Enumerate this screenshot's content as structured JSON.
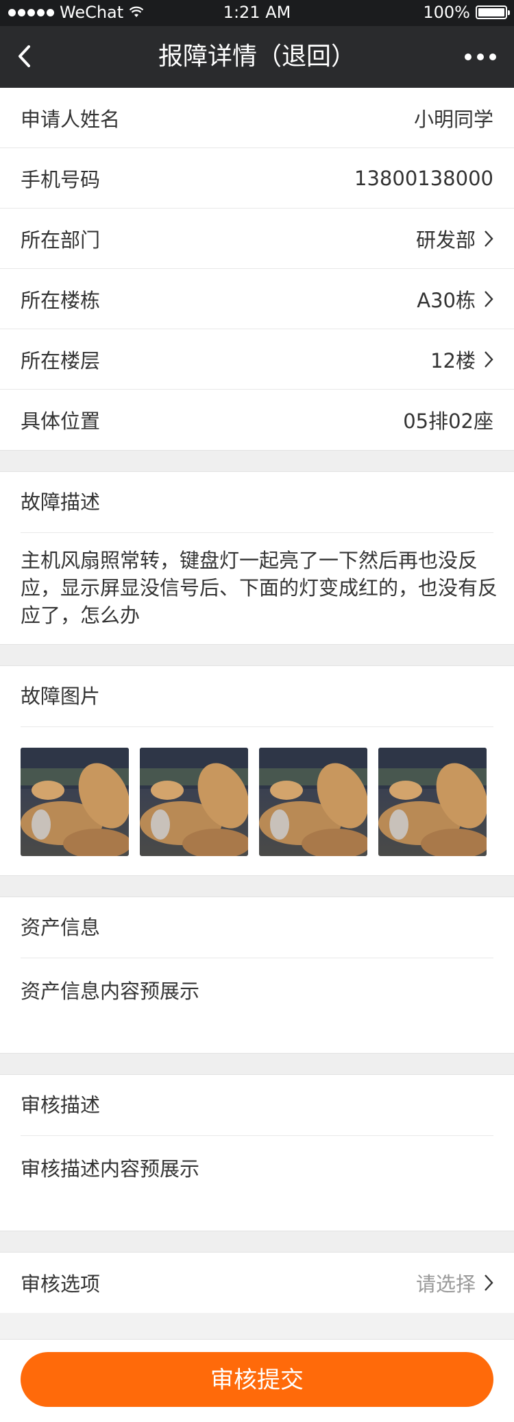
{
  "statusbar": {
    "carrier": "WeChat",
    "time": "1:21 AM",
    "battery": "100%"
  },
  "navbar": {
    "title": "报障详情（退回）"
  },
  "info_rows": [
    {
      "label": "申请人姓名",
      "value": "小明同学",
      "arrow": false
    },
    {
      "label": "手机号码",
      "value": "13800138000",
      "arrow": false
    },
    {
      "label": "所在部门",
      "value": "研发部",
      "arrow": true
    },
    {
      "label": "所在楼栋",
      "value": "A30栋",
      "arrow": true
    },
    {
      "label": "所在楼层",
      "value": "12楼",
      "arrow": true
    },
    {
      "label": "具体位置",
      "value": "05排02座",
      "arrow": false
    }
  ],
  "fault": {
    "title": "故障描述",
    "text": "主机风扇照常转，键盘灯一起亮了一下然后再也没反应，显示屏显没信号后、下面的灯变成红的，也没有反应了，怎么办"
  },
  "photos": {
    "title": "故障图片",
    "count": 4
  },
  "asset": {
    "title": "资产信息",
    "text": "资产信息内容预展示"
  },
  "review": {
    "title": "审核描述",
    "text": "审核描述内容预展示"
  },
  "option": {
    "label": "审核选项",
    "placeholder": "请选择"
  },
  "submit": {
    "label": "审核提交"
  },
  "colors": {
    "accent": "#ff6a0a",
    "navbar": "#2a2b2d"
  }
}
